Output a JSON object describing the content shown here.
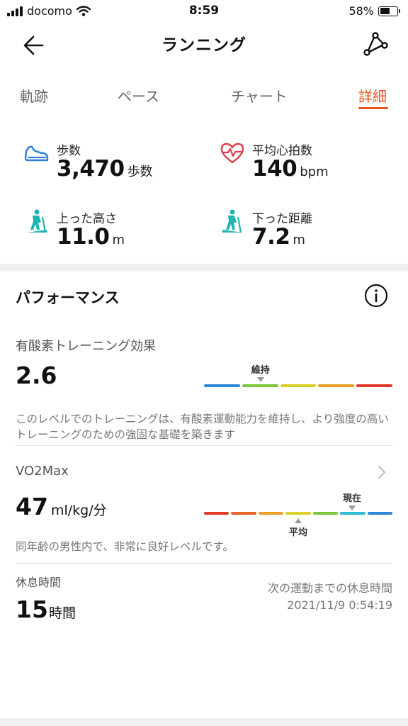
{
  "status_bar": {
    "carrier": "docomo",
    "time": "8:59",
    "battery_percent": "58%",
    "battery_level": 0.58
  },
  "header": {
    "title": "ランニング",
    "back_icon": "arrow-left-icon",
    "share_icon": "route-share-icon"
  },
  "tabs": [
    {
      "label": "軌跡",
      "active": false
    },
    {
      "label": "ペース",
      "active": false
    },
    {
      "label": "チャート",
      "active": false
    },
    {
      "label": "詳細",
      "active": true
    }
  ],
  "stats": {
    "steps": {
      "label": "歩数",
      "value": "3,470",
      "unit": "歩数",
      "icon": "shoe-icon"
    },
    "heart_rate": {
      "label": "平均心拍数",
      "value": "140",
      "unit": "bpm",
      "icon": "heart-rate-icon"
    },
    "ascent": {
      "label": "上った高さ",
      "value": "11.0",
      "unit": "m",
      "icon": "hiker-uphill-icon"
    },
    "descent": {
      "label": "下った距離",
      "value": "7.2",
      "unit": "m",
      "icon": "hiker-downhill-icon"
    }
  },
  "performance": {
    "title": "パフォーマンス",
    "info_icon": "info-icon",
    "aerobic": {
      "label": "有酸素トレーニング効果",
      "value": "2.6",
      "level_label": "維持",
      "level_index": 1,
      "scale_colors": [
        "#2a8ad8",
        "#7ec63b",
        "#d8d12a",
        "#e8a126",
        "#e23a2a"
      ],
      "description": "このレベルでのトレーニングは、有酸素運動能力を維持し、より強度の高いトレーニングのための強固な基礎を築きます"
    },
    "vo2max": {
      "label": "VO2Max",
      "value": "47",
      "unit": "ml/kg/分",
      "current_label": "現在",
      "current_index": 5,
      "average_label": "平均",
      "average_index": 3,
      "scale_colors": [
        "#e23a2a",
        "#e8642a",
        "#e8a126",
        "#d8d12a",
        "#7ec63b",
        "#2abccf",
        "#2a8ad8"
      ],
      "description": "同年齢の男性内で、非常に良好レベルです。"
    },
    "rest": {
      "label": "休息時間",
      "value": "15",
      "unit": "時間",
      "next_label": "次の運動までの休息時間",
      "next_time": "2021/11/9 0:54:19"
    }
  }
}
